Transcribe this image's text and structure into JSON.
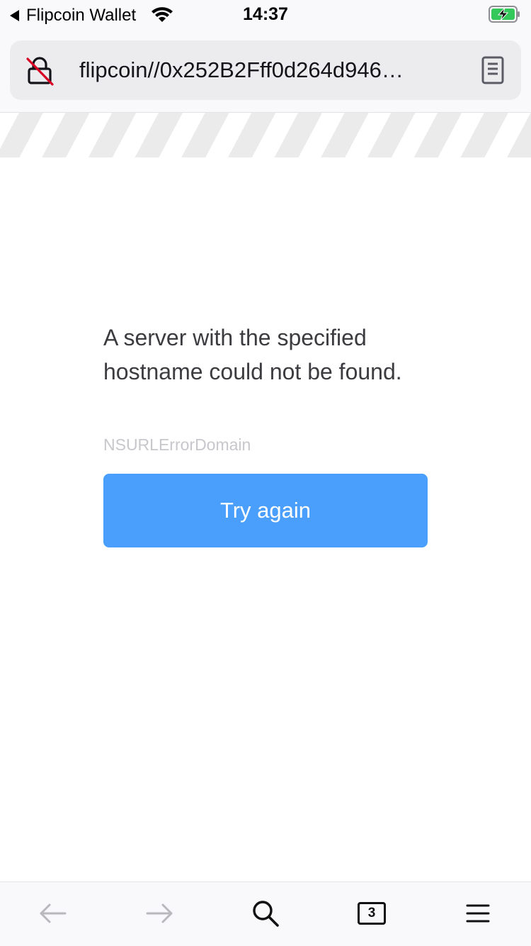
{
  "status_bar": {
    "back_app_label": "Flipcoin Wallet",
    "time": "14:37",
    "icons": [
      "back-triangle-icon",
      "wifi-icon",
      "battery-charging-icon"
    ],
    "battery_color": "#34c759"
  },
  "url_bar": {
    "url": "flipcoin//0x252B2Fff0d264d946…",
    "lock_icon": "insecure-lock-icon",
    "reader_icon": "reader-mode-icon",
    "lock_slash_color": "#d70022"
  },
  "error": {
    "message": "A server with the specified hostname could not be found.",
    "domain": "NSURLErrorDomain",
    "button_label": "Try again",
    "button_color": "#4a9ffd"
  },
  "toolbar": {
    "back_icon": "arrow-left-icon",
    "forward_icon": "arrow-right-icon",
    "search_icon": "search-icon",
    "tab_count": "3",
    "menu_icon": "hamburger-menu-icon"
  }
}
